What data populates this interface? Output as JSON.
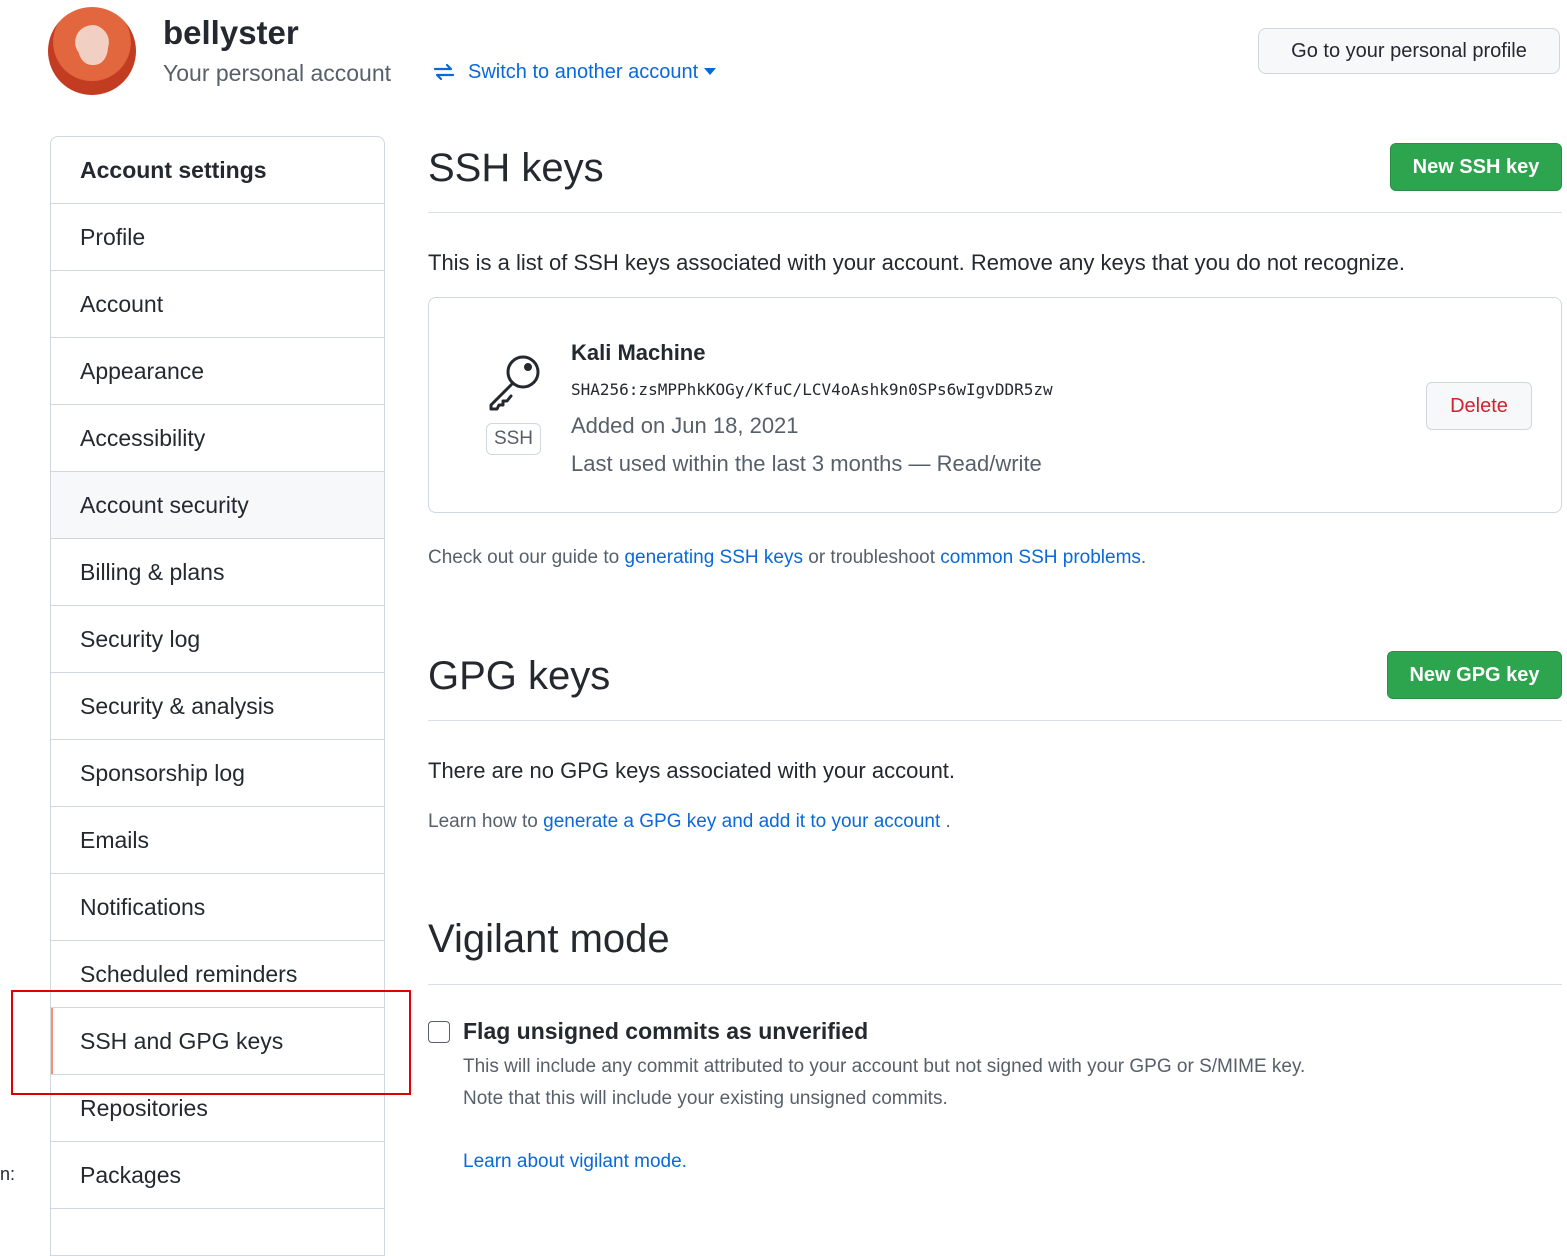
{
  "header": {
    "username": "bellyster",
    "account_type": "Your personal account",
    "switch_label": "Switch to another account",
    "profile_button": "Go to your personal profile"
  },
  "sidebar": {
    "heading": "Account settings",
    "items": [
      {
        "label": "Profile"
      },
      {
        "label": "Account"
      },
      {
        "label": "Appearance"
      },
      {
        "label": "Accessibility"
      },
      {
        "label": "Account security"
      },
      {
        "label": "Billing & plans"
      },
      {
        "label": "Security log"
      },
      {
        "label": "Security & analysis"
      },
      {
        "label": "Sponsorship log"
      },
      {
        "label": "Emails"
      },
      {
        "label": "Notifications"
      },
      {
        "label": "Scheduled reminders"
      },
      {
        "label": "SSH and GPG keys"
      },
      {
        "label": "Repositories"
      },
      {
        "label": "Packages"
      }
    ],
    "hovered_item": "Account security",
    "selected_item": "SSH and GPG keys"
  },
  "edge_fragment": "n:",
  "ssh": {
    "title": "SSH keys",
    "new_button": "New SSH key",
    "description": "This is a list of SSH keys associated with your account. Remove any keys that you do not recognize.",
    "key": {
      "name": "Kali Machine",
      "fingerprint": "SHA256:zsMPPhkKOGy/KfuC/LCV4oAshk9n0SPs6wIgvDDR5zw",
      "added": "Added on Jun 18, 2021",
      "last_used": "Last used within the last 3 months — Read/write",
      "type_label": "SSH",
      "delete_button": "Delete",
      "icon": "key-icon"
    },
    "help_prefix": "Check out our guide to ",
    "help_link1": "generating SSH keys",
    "help_middle": " or troubleshoot ",
    "help_link2": "common SSH problems",
    "help_suffix": "."
  },
  "gpg": {
    "title": "GPG keys",
    "new_button": "New GPG key",
    "empty_text": "There are no GPG keys associated with your account.",
    "learn_prefix": "Learn how to ",
    "learn_link": "generate a GPG key and add it to your account",
    "learn_suffix": " ."
  },
  "vigilant": {
    "title": "Vigilant mode",
    "checkbox_label": "Flag unsigned commits as unverified",
    "checked": false,
    "note1": "This will include any commit attributed to your account but not signed with your GPG or S/MIME key.",
    "note2": "Note that this will include your existing unsigned commits.",
    "learn_link": "Learn about vigilant mode."
  },
  "colors": {
    "accent_link": "#0969da",
    "primary_button": "#2da44e",
    "danger": "#cf222e",
    "selected_marker": "#fd8c73",
    "annotation_box": "#e00000"
  }
}
